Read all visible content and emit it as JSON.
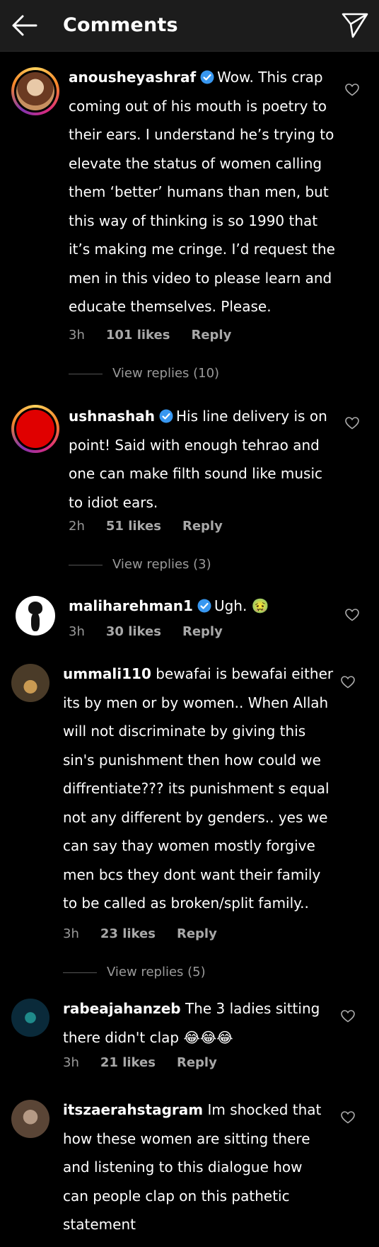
{
  "header": {
    "title": "Comments"
  },
  "comments": [
    {
      "username": "anousheyashraf",
      "verified": true,
      "text": "Wow. This crap coming out of his mouth is poetry to their ears. I understand he’s trying to elevate the status of women calling them ‘better’ humans than men, but this way of thinking is so 1990 that it’s making me cringe. I’d request the men in this video to please learn and educate themselves. Please.",
      "lines": [
        "coming out of his mouth is poetry to",
        "their ears. I understand he’s trying to",
        "elevate the status of women calling",
        "them ‘better’ humans than men, but",
        "this way of thinking is so 1990 that",
        "it’s making me cringe. I’d request the",
        "men in this video to please learn and",
        "educate themselves. Please."
      ],
      "first_line": "Wow. This crap",
      "time": "3h",
      "likes": "101 likes",
      "reply": "Reply",
      "view_replies": "View replies (10)"
    },
    {
      "username": "ushnashah",
      "verified": true,
      "first_line": "His line delivery is on",
      "lines": [
        "point! Said with enough tehrao and",
        "one can make filth sound like music",
        "to idiot ears."
      ],
      "time": "2h",
      "likes": "51 likes",
      "reply": "Reply",
      "view_replies": "View replies (3)"
    },
    {
      "username": "maliharehman1",
      "verified": true,
      "first_line": "Ugh. 🤢",
      "lines": [],
      "time": "3h",
      "likes": "30 likes",
      "reply": "Reply"
    },
    {
      "username": "ummali110",
      "verified": false,
      "first_line": "bewafai is bewafai either",
      "lines": [
        "its by men or by women.. When Allah",
        "will not discriminate by giving this",
        "sin's punishment then how could we",
        "diffrentiate??? its punishment s equal",
        "not any different by genders.. yes we",
        "can say thay women mostly forgive",
        "men bcs they dont want their  family",
        "to be called as broken/split family.."
      ],
      "time": "3h",
      "likes": "23 likes",
      "reply": "Reply",
      "view_replies": "View replies (5)"
    },
    {
      "username": "rabeajahanzeb",
      "verified": false,
      "first_line": "The 3 ladies sitting",
      "lines": [
        "there didn't clap 😂😂😂"
      ],
      "time": "3h",
      "likes": "21 likes",
      "reply": "Reply"
    },
    {
      "username": "itszaerahstagram",
      "verified": false,
      "first_line": "Im shocked that",
      "lines": [
        "how these women are sitting there",
        "and listening to this dialogue how",
        "can people clap on this pathetic",
        "statement"
      ]
    }
  ],
  "colors": {
    "verified": "#3897f0",
    "muted": "#9a9a9a",
    "topbar": "#1c1c1c"
  },
  "icons": {
    "back": "back-arrow-icon",
    "send": "paper-plane-icon",
    "like": "heart-icon"
  }
}
